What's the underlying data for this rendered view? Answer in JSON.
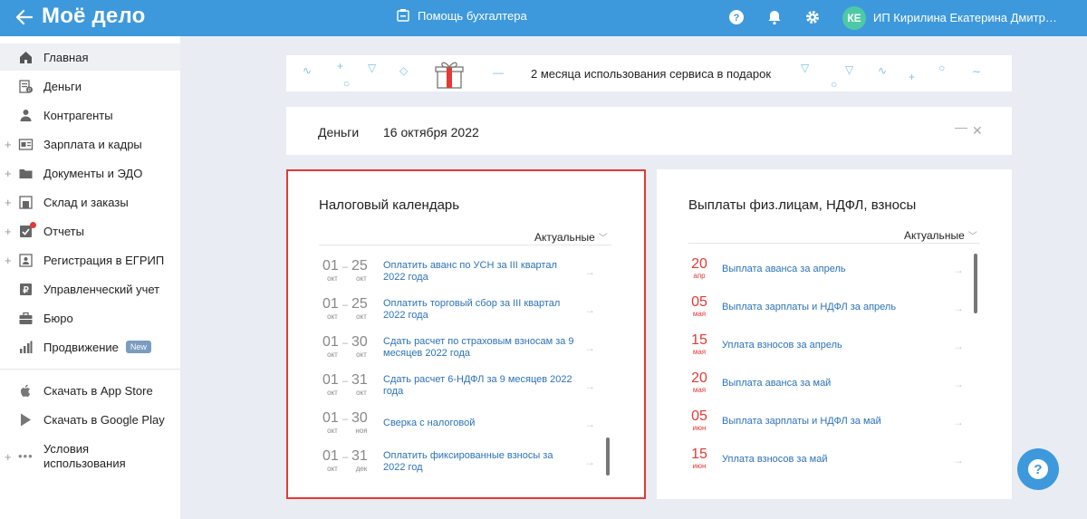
{
  "topbar": {
    "logo": "Моё дело",
    "helper_label": "Помощь бухгалтера",
    "avatar_initials": "КЕ",
    "user_name": "ИП Кирилина Екатерина Дмитриевна"
  },
  "sidebar": {
    "items": [
      {
        "label": "Главная",
        "icon": "home-icon",
        "expandable": false
      },
      {
        "label": "Деньги",
        "icon": "money-icon",
        "expandable": false
      },
      {
        "label": "Контрагенты",
        "icon": "contractors-icon",
        "expandable": false
      },
      {
        "label": "Зарплата и кадры",
        "icon": "salary-icon",
        "expandable": true
      },
      {
        "label": "Документы и ЭДО",
        "icon": "documents-icon",
        "expandable": true
      },
      {
        "label": "Склад и заказы",
        "icon": "warehouse-icon",
        "expandable": true
      },
      {
        "label": "Отчеты",
        "icon": "reports-icon",
        "expandable": true
      },
      {
        "label": "Регистрация в ЕГРИП",
        "icon": "registration-icon",
        "expandable": true
      },
      {
        "label": "Управленческий учет",
        "icon": "management-icon",
        "expandable": false
      },
      {
        "label": "Бюро",
        "icon": "bureau-icon",
        "expandable": false
      },
      {
        "label": "Продвижение",
        "icon": "promotion-icon",
        "expandable": false,
        "badge": "New"
      }
    ],
    "bottom_items": [
      {
        "label": "Скачать в App Store",
        "icon": "apple-icon"
      },
      {
        "label": "Скачать в Google Play",
        "icon": "google-play-icon"
      },
      {
        "label": "Условия использования",
        "label_line1": "Условия",
        "label_line2": "использования",
        "icon": "more-icon"
      }
    ]
  },
  "banner": {
    "text": "2 месяца использования сервиса в подарок"
  },
  "money_card": {
    "title": "Деньги",
    "date": "16 октября 2022",
    "minimize": "—",
    "close": "✕"
  },
  "tax_calendar": {
    "title": "Налоговый календарь",
    "filter": "Актуальные",
    "rows": [
      {
        "from_day": "01",
        "from_mon": "окт",
        "to_day": "25",
        "to_mon": "окт",
        "line1": "Оплатить аванс по УСН за III квартал",
        "line2": "2022 года"
      },
      {
        "from_day": "01",
        "from_mon": "окт",
        "to_day": "25",
        "to_mon": "окт",
        "line1": "Оплатить торговый сбор за III квартал",
        "line2": "2022 года"
      },
      {
        "from_day": "01",
        "from_mon": "окт",
        "to_day": "30",
        "to_mon": "окт",
        "line1": "Сдать расчет по страховым взносам за 9",
        "line2": "месяцев 2022 года"
      },
      {
        "from_day": "01",
        "from_mon": "окт",
        "to_day": "31",
        "to_mon": "окт",
        "line1": "Сдать расчет 6-НДФЛ за 9 месяцев 2022",
        "line2": "года"
      },
      {
        "from_day": "01",
        "from_mon": "окт",
        "to_day": "30",
        "to_mon": "ноя",
        "line1": "Сверка с налоговой",
        "line2": ""
      },
      {
        "from_day": "01",
        "from_mon": "окт",
        "to_day": "31",
        "to_mon": "дек",
        "line1": "Оплатить фиксированные взносы за",
        "line2": "2022 год"
      }
    ]
  },
  "payouts": {
    "title": "Выплаты физ.лицам, НДФЛ, взносы",
    "filter": "Актуальные",
    "rows": [
      {
        "day": "20",
        "mon": "апр",
        "text": "Выплата аванса за апрель"
      },
      {
        "day": "05",
        "mon": "мая",
        "text": "Выплата зарплаты и НДФЛ за апрель"
      },
      {
        "day": "15",
        "mon": "мая",
        "text": "Уплата взносов за апрель"
      },
      {
        "day": "20",
        "mon": "мая",
        "text": "Выплата аванса за май"
      },
      {
        "day": "05",
        "mon": "июн",
        "text": "Выплата зарплаты и НДФЛ за май"
      },
      {
        "day": "15",
        "mon": "июн",
        "text": "Уплата взносов за май"
      }
    ]
  },
  "colors": {
    "brand": "#3d99dc",
    "accent_red": "#e53935",
    "link": "#2b72b8"
  }
}
